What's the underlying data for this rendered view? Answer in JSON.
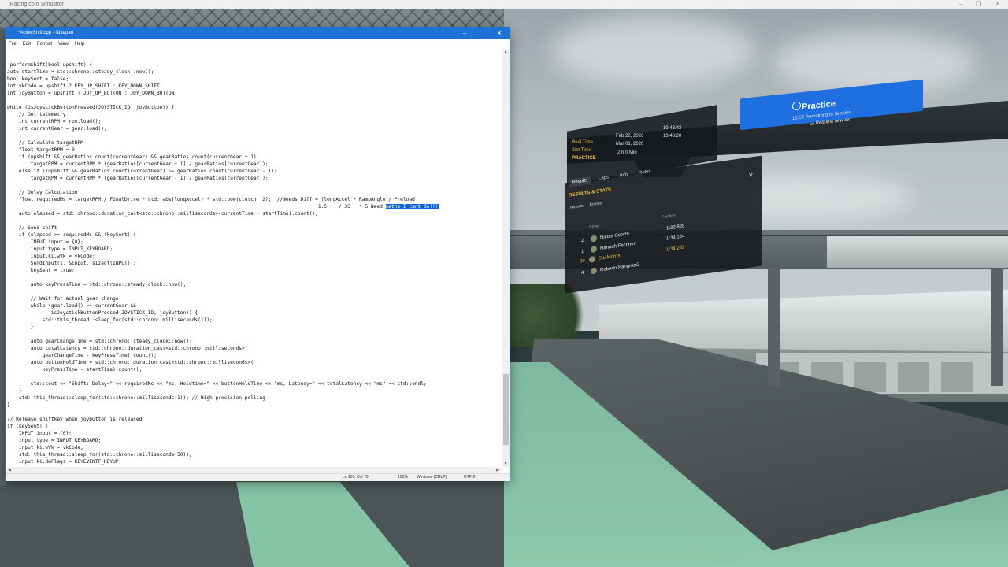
{
  "host": {
    "title": "iRacing.com Simulator",
    "controls": [
      "–",
      "❐",
      "✕"
    ]
  },
  "notepad": {
    "title": "*ActiveShift.cpp - Notepad",
    "menu": [
      "File",
      "Edit",
      "Format",
      "View",
      "Help"
    ],
    "code_lines": [
      " performShift(bool upshift) {",
      "auto startTime = std::chrono::steady_clock::now();",
      "bool keySent = false;",
      "int vkCode = upshift ? KEY_UP_SHIFT : KEY_DOWN_SHIFT;",
      "int joyButton = upshift ? JOY_UP_BUTTON : JOY_DOWN_BUTTON;",
      "",
      "while (isJoystickButtonPressed(JOYSTICK_ID, joyButton)) {",
      "    // Get telemetry",
      "    int currentRPM = rpm.load();",
      "    int currentGear = gear.load();",
      "",
      "    // Calculate targetRPM",
      "    float targetRPM = 0;",
      "    if (upshift && gearRatios.count(currentGear) && gearRatios.count(currentGear + 1))",
      "        targetRPM = currentRPM * (gearRatios[currentGear + 1] / gearRatios[currentGear]);",
      "    else if (!upshift && gearRatios.count(currentGear) && gearRatios.count(currentGear - 1))",
      "        targetRPM = currentRPM * (gearRatios[currentGear - 1] / gearRatios[currentGear]);",
      "",
      "    // Delay Calculation",
      "    float requiredMs = targetRPM / FinalDrive * std::abs(longAccel) * std::pow(clutch, 2);  //Needs Diff = (longAccel * RampAngle / Preload",
      "                                                                                                          1.5    / 35   * 5 Need ",
      "    auto elapsed = std::chrono::duration_cast<std::chrono::milliseconds>(currentTime - startTime).count();",
      "",
      "    // Send shift",
      "    if (elapsed >= requiredMs && !keySent) {",
      "        INPUT input = {0};",
      "        input.type = INPUT_KEYBOARD;",
      "        input.ki.wVk = vkCode;",
      "        SendInput(1, &input, sizeof(INPUT));",
      "        keySent = true;",
      "",
      "        auto keyPressTime = std::chrono::steady_clock::now();",
      "",
      "        // Wait for actual gear change",
      "        while (gear.load() == currentGear &&",
      "               isJoystickButtonPressed(JOYSTICK_ID, joyButton)) {",
      "            std::this_thread::sleep_for(std::chrono::milliseconds(1));",
      "        }",
      "",
      "        auto gearChangeTime = std::chrono::steady_clock::now();",
      "        auto totalLatency = std::chrono::duration_cast<std::chrono::milliseconds>(",
      "            gearChangeTime - keyPressTime).count();",
      "        auto buttonHoldTime = std::chrono::duration_cast<std::chrono::milliseconds>(",
      "            keyPressTime - startTime).count();",
      "",
      "        std::cout << \"Shift: Delay=\" << requiredMs << \"ms, Holdtime=\" << buttonHoldTime << \"ms, Latency=\" << totalLatency << \"ms\" << std::endl;",
      "    }",
      "    std::this_thread::sleep_for(std::chrono::milliseconds(1)); // High precision polling",
      "}",
      "",
      "// Release shiftkey when joybutton is released",
      "if (keySent) {",
      "    INPUT input = {0};",
      "    input.type = INPUT_KEYBOARD;",
      "    input.ki.wVk = vkCode;",
      "    std::this_thread::sleep_for(std::chrono::milliseconds(50));",
      "    input.ki.dwFlags = KEYEVENTF_KEYUP;"
    ],
    "selected_text": "maths I cant do!!!",
    "selected_line_index": 20,
    "status": {
      "position": "Ln 257, Col 70",
      "zoom": "100%",
      "line_ending": "Windows (CRLF)",
      "encoding": "UTF-8"
    }
  },
  "session": {
    "button_title": "Practice",
    "remaining": "10:59 Remaining in Session",
    "request_car": "Request new car",
    "info": [
      {
        "label": "Real Time",
        "value": "Feb 22, 2026",
        "time": "19:43:43"
      },
      {
        "label": "Sim Time",
        "value": "Mar 01, 2026",
        "time": "13:43:20"
      },
      {
        "label": "",
        "value": "2 h 0 Min",
        "time": ""
      }
    ],
    "mode": "PRACTICE"
  },
  "results": {
    "tabs": [
      "Results",
      "Laps",
      "Info",
      "Rules"
    ],
    "title": "RESULTS & STATS",
    "subtabs": [
      "Results",
      "Entries"
    ],
    "col_driver": "Driver",
    "col_position": "Position",
    "rows": [
      {
        "pos": "2",
        "name": "Nicola Cocchi",
        "time": "1:32.828"
      },
      {
        "pos": "1",
        "name": "Hannah Fechner",
        "time": "1:34.154"
      },
      {
        "pos": "99",
        "name": "Stu Morris",
        "time": "1:34.262"
      },
      {
        "pos": "4",
        "name": "Roberto Pangrazi2",
        "time": ""
      }
    ]
  },
  "colors": {
    "notepad_title": "#1e73d8",
    "practice": "#1f6fe0",
    "highlight": "#f0c040",
    "selection": "#0a64d8"
  }
}
